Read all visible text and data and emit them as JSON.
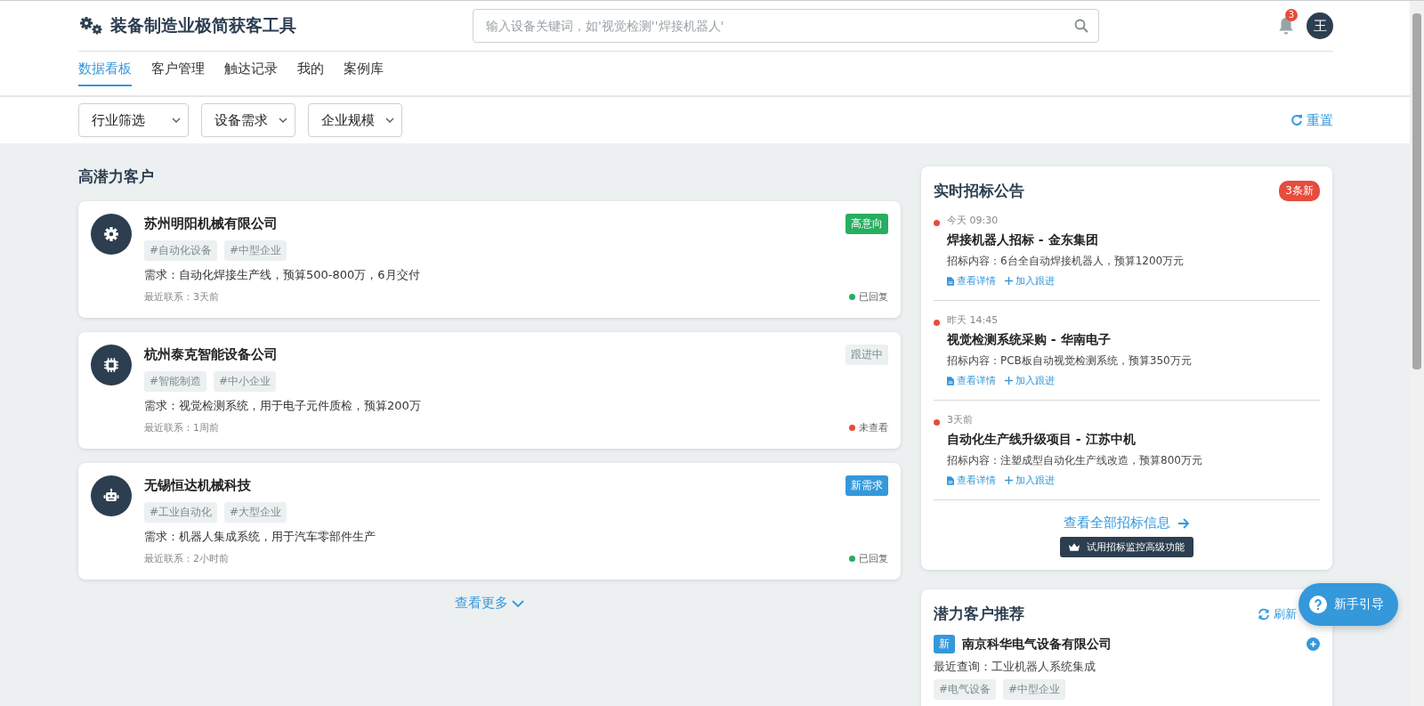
{
  "header": {
    "title": "装备制造业极简获客工具",
    "search_placeholder": "输入设备关键词，如'视觉检测''焊接机器人'",
    "notification_count": "3",
    "avatar": "王"
  },
  "tabs": [
    {
      "label": "数据看板",
      "selected": true
    },
    {
      "label": "客户管理",
      "selected": false
    },
    {
      "label": "触达记录",
      "selected": false
    },
    {
      "label": "我的",
      "selected": false
    },
    {
      "label": "案例库",
      "selected": false
    }
  ],
  "filters": [
    "行业筛选",
    "设备需求",
    "企业规模"
  ],
  "reset": "重置",
  "customers_section": {
    "title": "高潜力客户",
    "more": "查看更多",
    "customers": [
      {
        "kind": "gear",
        "name": "苏州明阳机械有限公司",
        "tags": [
          "#自动化设备",
          "#中型企业"
        ],
        "need": "需求：自动化焊接生产线，预算500-800万，6月交付",
        "last_contact": "最近联系：3天前",
        "badge": {
          "text": "高意向",
          "kind": "high"
        },
        "status": {
          "text": "已回复",
          "color": "#27ae60"
        }
      },
      {
        "kind": "chip",
        "name": "杭州泰克智能设备公司",
        "tags": [
          "#智能制造",
          "#中小企业"
        ],
        "need": "需求：视觉检测系统，用于电子元件质检，预算200万",
        "last_contact": "最近联系：1周前",
        "badge": {
          "text": "跟进中",
          "kind": "following"
        },
        "status": {
          "text": "未查看",
          "color": "#e74c3c"
        }
      },
      {
        "kind": "robot",
        "name": "无锡恒达机械科技",
        "tags": [
          "#工业自动化",
          "#大型企业"
        ],
        "need": "需求：机器人集成系统，用于汽车零部件生产",
        "last_contact": "最近联系：2小时前",
        "badge": {
          "text": "新需求",
          "kind": "new"
        },
        "status": {
          "text": "已回复",
          "color": "#27ae60"
        }
      }
    ]
  },
  "bids": {
    "title": "实时招标公告",
    "badge": "3条新",
    "items": [
      {
        "time": "今天 09:30",
        "title": "焊接机器人招标 - 金东集团",
        "content": "招标内容：6台全自动焊接机器人，预算1200万元",
        "actions": [
          "查看详情",
          "加入跟进"
        ]
      },
      {
        "time": "昨天 14:45",
        "title": "视觉检测系统采购 - 华南电子",
        "content": "招标内容：PCB板自动视觉检测系统，预算350万元",
        "actions": [
          "查看详情",
          "加入跟进"
        ]
      },
      {
        "time": "3天前",
        "title": "自动化生产线升级项目 - 江苏中机",
        "content": "招标内容：注塑成型自动化生产线改造，预算800万元",
        "actions": [
          "查看详情",
          "加入跟进"
        ]
      }
    ],
    "view_all": "查看全部招标信息",
    "promo": "试用招标监控高级功能"
  },
  "recommend": {
    "title": "潜力客户推荐",
    "refresh": "刷新",
    "items": [
      {
        "badge": "新",
        "name": "南京科华电气设备有限公司",
        "query": "最近查询：工业机器人系统集成",
        "tags": [
          "#电气设备",
          "#中型企业"
        ]
      }
    ]
  },
  "help": "新手引导"
}
